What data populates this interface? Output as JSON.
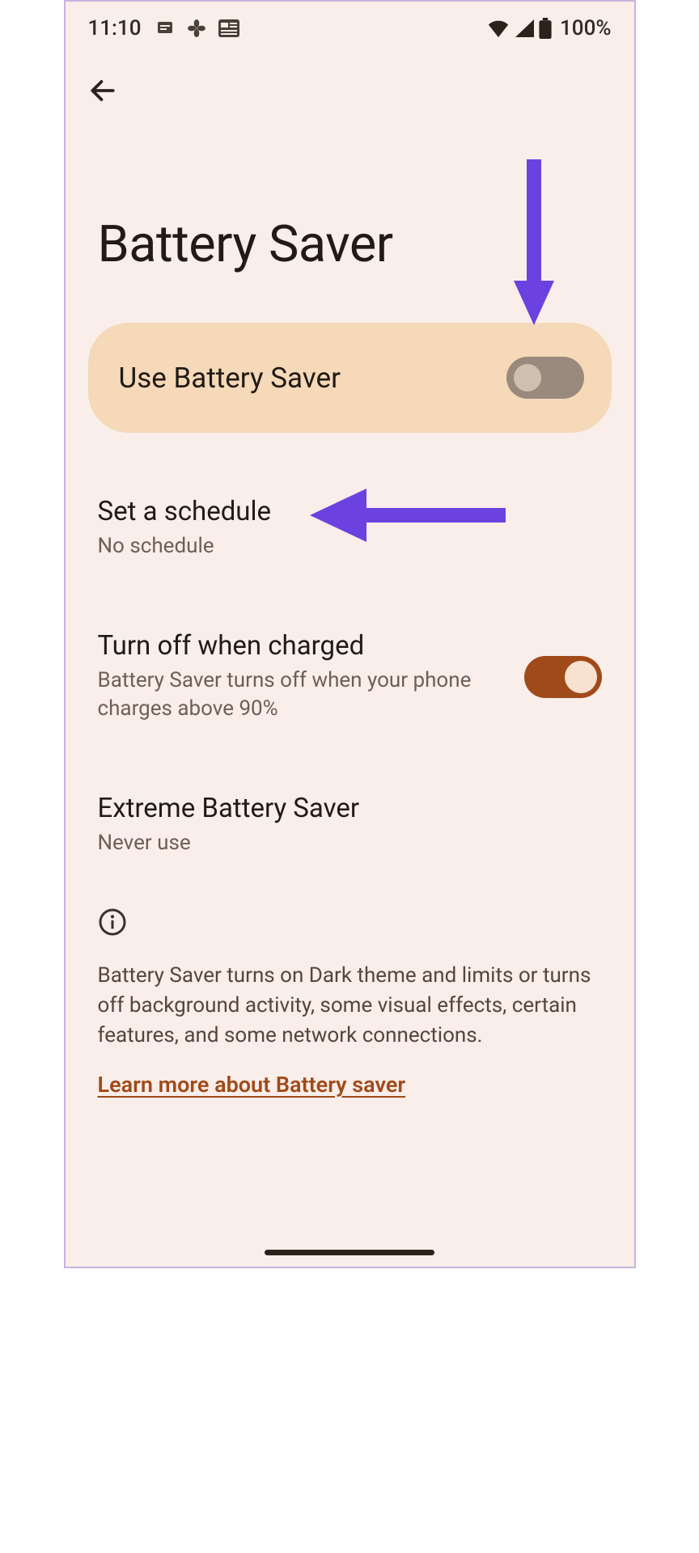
{
  "status": {
    "time": "11:10",
    "battery_text": "100%"
  },
  "title": "Battery Saver",
  "main_toggle": {
    "label": "Use Battery Saver"
  },
  "schedule": {
    "title": "Set a schedule",
    "sub": "No schedule"
  },
  "turn_off": {
    "title": "Turn off when charged",
    "sub": "Battery Saver turns off when your phone charges above 90%"
  },
  "extreme": {
    "title": "Extreme Battery Saver",
    "sub": "Never use"
  },
  "info": {
    "text": "Battery Saver turns on Dark theme and limits or turns off background activity, some visual effects, certain features, and some network connections.",
    "link": "Learn more about Battery saver"
  }
}
